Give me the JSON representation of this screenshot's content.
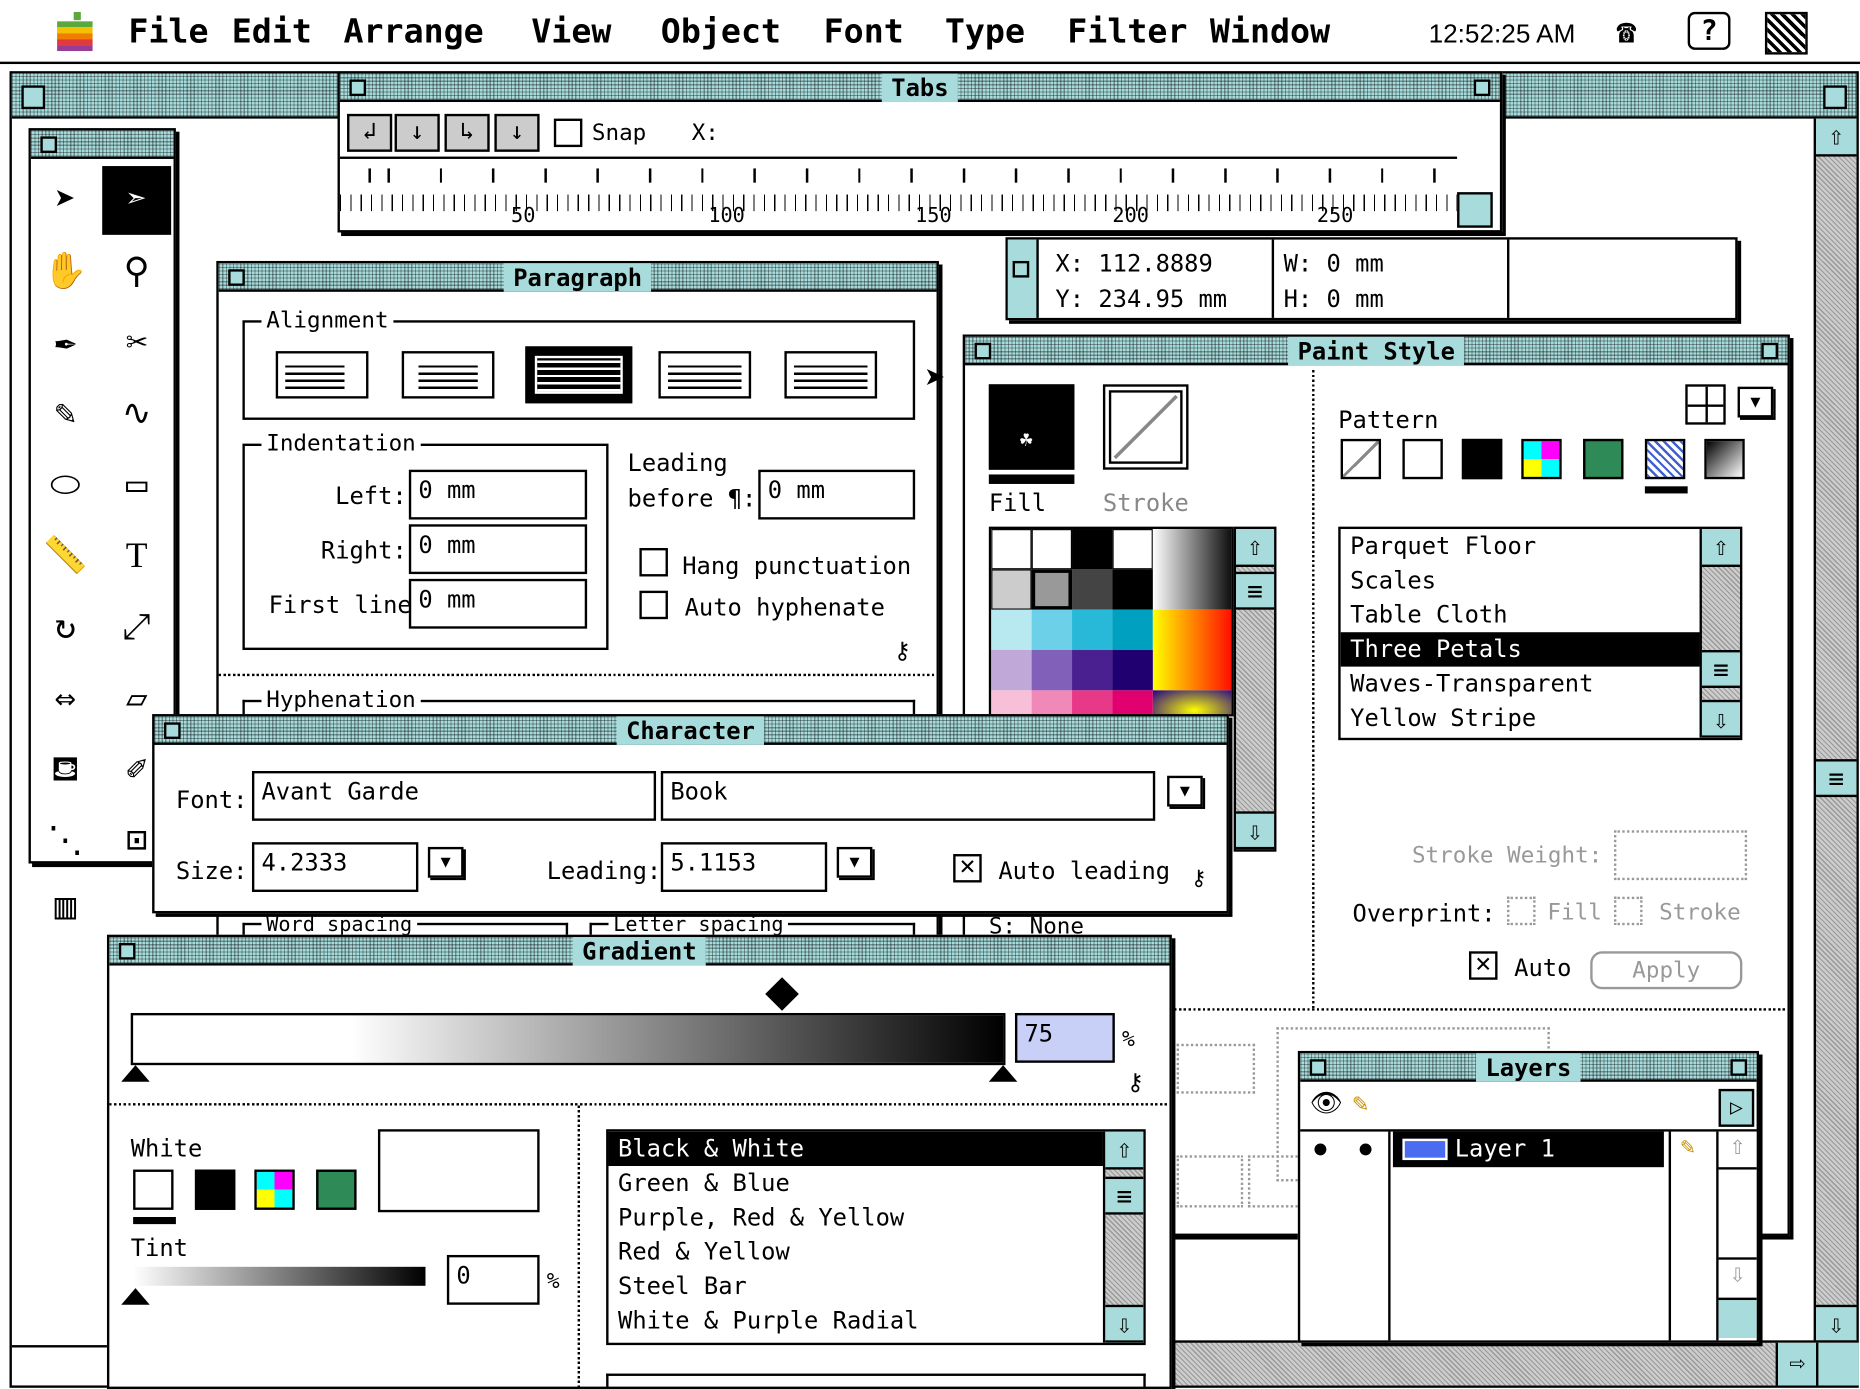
{
  "menubar": {
    "items": [
      "File",
      "Edit",
      "Arrange",
      "View",
      "Object",
      "Font",
      "Type",
      "Filter",
      "Window"
    ],
    "clock": "12:52:25 AM"
  },
  "tabs": {
    "title": "Tabs",
    "snap": "Snap",
    "x_label": "X:",
    "ruler": [
      "50",
      "100",
      "150",
      "200",
      "250"
    ]
  },
  "info": {
    "x": "X: 112.8889",
    "y": "Y: 234.95 mm",
    "w": "W: 0 mm",
    "h": "H: 0 mm"
  },
  "paragraph": {
    "title": "Paragraph",
    "alignment": "Alignment",
    "indentation": "Indentation",
    "left": "Left:",
    "right": "Right:",
    "first_line": "First line:",
    "left_val": "0 mm",
    "right_val": "0 mm",
    "first_val": "0 mm",
    "leading": "Leading",
    "before": "before ¶:",
    "before_val": "0 mm",
    "hang": "Hang punctuation",
    "auto_hyph": "Auto hyphenate",
    "hyphenation": "Hyphenation",
    "word_spacing": "Word spacing",
    "letter_spacing": "Letter spacing"
  },
  "paint": {
    "title": "Paint Style",
    "fill": "Fill",
    "stroke": "Stroke",
    "pattern": "Pattern",
    "patterns": [
      "Parquet Floor",
      "Scales",
      "Table Cloth",
      "Three Petals",
      "Waves-Transparent",
      "Yellow Stripe"
    ],
    "selected": "Three Petals",
    "stroke_weight": "Stroke Weight:",
    "overprint": "Overprint:",
    "op_fill": "Fill",
    "op_stroke": "Stroke",
    "auto": "Auto",
    "apply": "Apply",
    "s_none": "S: None"
  },
  "character": {
    "title": "Character",
    "font_label": "Font:",
    "font": "Avant Garde",
    "style": "Book",
    "size_label": "Size:",
    "size": "4.2333",
    "leading_label": "Leading:",
    "leading": "5.1153",
    "auto_leading": "Auto leading"
  },
  "gradient": {
    "title": "Gradient",
    "pct": "75",
    "pct_sign": "%",
    "white": "White",
    "tint": "Tint",
    "tint_val": "0",
    "tint_sign": "%",
    "list": [
      "Black & White",
      "Green & Blue",
      "Purple, Red & Yellow",
      "Red & Yellow",
      "Steel Bar",
      "White & Purple Radial"
    ],
    "selected": "Black & White"
  },
  "layers": {
    "title": "Layers",
    "layer": "Layer 1",
    "layer_color": "#4a6cf0"
  },
  "colors": {
    "titlebar": "#a8dcdc",
    "highlight": "#000000"
  }
}
